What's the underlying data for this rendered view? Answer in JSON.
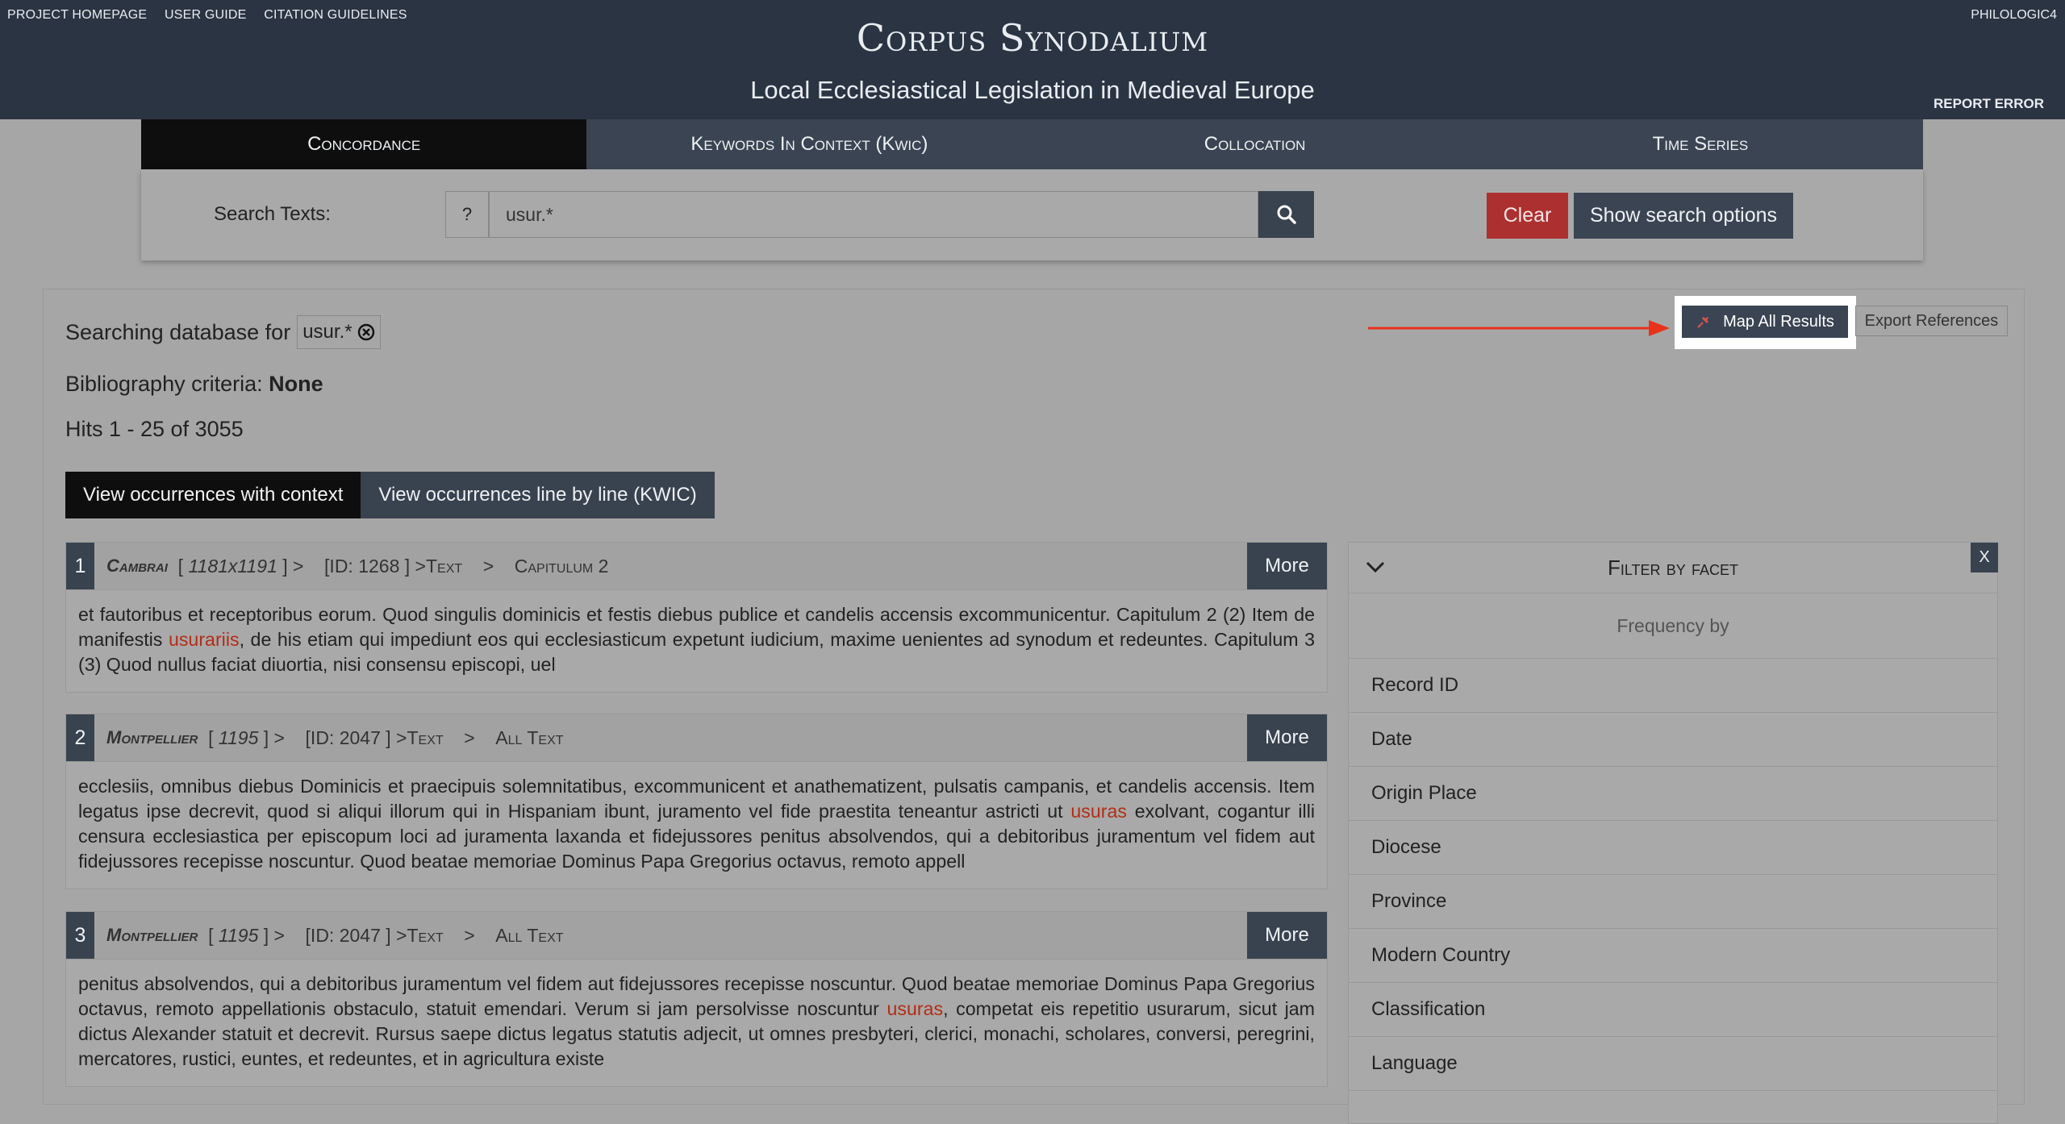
{
  "header": {
    "links": [
      "PROJECT HOMEPAGE",
      "USER GUIDE",
      "CITATION GUIDELINES"
    ],
    "brand_right": "PHILOLOGIC4",
    "title": "Corpus Synodalium",
    "subtitle": "Local Ecclesiastical Legislation in Medieval Europe",
    "report_error": "REPORT ERROR"
  },
  "tabs": [
    "Concordance",
    "Keywords In Context (Kwic)",
    "Collocation",
    "Time Series"
  ],
  "search": {
    "label": "Search Texts:",
    "help": "?",
    "value": "usur.*",
    "clear_label": "Clear",
    "options_label": "Show search options"
  },
  "results": {
    "searching_label": "Searching database for",
    "term": "usur.*",
    "biblio_label": "Bibliography criteria:",
    "biblio_value": "None",
    "hits": "Hits 1 - 25 of 3055",
    "view_context": "View occurrences with context",
    "view_kwic": "View occurrences line by line (KWIC)",
    "map_label": "Map All Results",
    "export_label": "Export References",
    "more_label": "More"
  },
  "cards": [
    {
      "num": "1",
      "place": "Cambrai",
      "date": "1181x1191",
      "id": "[ID: 1268 ] >",
      "section": "Capitulum 2",
      "text_before": "et fautoribus et receptoribus eorum. Quod singulis dominicis et festis diebus publice et candelis accensis excommunicentur. Capitulum 2 (2) Item de manifestis ",
      "highlight": "usurariis",
      "text_after": ", de his etiam qui impediunt eos qui ecclesiasticum expetunt iudicium, maxime uenientes ad synodum et redeuntes. Capitulum 3 (3) Quod nullus faciat diuortia, nisi consensu episcopi, uel"
    },
    {
      "num": "2",
      "place": "Montpellier",
      "date": "1195",
      "id": "[ID: 2047 ] >",
      "section": "All Text",
      "text_before": "ecclesiis, omnibus diebus Dominicis et praecipuis solemnitatibus, excommunicent et anathematizent, pulsatis campanis, et candelis accensis. Item legatus ipse decrevit, quod si aliqui illorum qui in Hispaniam ibunt, juramento vel fide praestita teneantur astricti ut ",
      "highlight": "usuras",
      "text_after": " exolvant, cogantur illi censura ecclesiastica per episcopum loci ad juramenta laxanda et fidejussores penitus absolvendos, qui a debitoribus juramentum vel fidem aut fidejussores recepisse noscuntur. Quod beatae memoriae Dominus Papa Gregorius octavus, remoto appell"
    },
    {
      "num": "3",
      "place": "Montpellier",
      "date": "1195",
      "id": "[ID: 2047 ] >",
      "section": "All Text",
      "text_before": "penitus absolvendos, qui a debitoribus juramentum vel fidem aut fidejussores recepisse noscuntur. Quod beatae memoriae Dominus Papa Gregorius octavus, remoto appellationis obstaculo, statuit emendari. Verum si jam persolvisse noscuntur ",
      "highlight": "usuras",
      "text_after": ", competat eis repetitio usurarum, sicut jam dictus Alexander statuit et decrevit. Rursus saepe dictus legatus statutis adjecit, ut omnes presbyteri, clerici, monachi, scholares, conversi, peregrini, mercatores, rustici, euntes, et redeuntes, et in agricultura existe"
    }
  ],
  "card_text_label": "Text",
  "facets": {
    "title": "Filter by facet",
    "close": "X",
    "frequency_label": "Frequency by",
    "items": [
      "Record ID",
      "Date",
      "Origin Place",
      "Diocese",
      "Province",
      "Modern Country",
      "Classification",
      "Language"
    ]
  },
  "colors": {
    "header_bg": "#2b3442",
    "button_bg": "#3a4452",
    "clear_bg": "#ad3030",
    "highlight": "#b32d17",
    "arrow": "#e8321c",
    "page_bg": "#a6a6a6"
  },
  "icons": {
    "search": "magnifier-icon",
    "pin": "map-pin-icon",
    "chevron": "chevron-down-icon",
    "remove": "circle-x-icon"
  }
}
